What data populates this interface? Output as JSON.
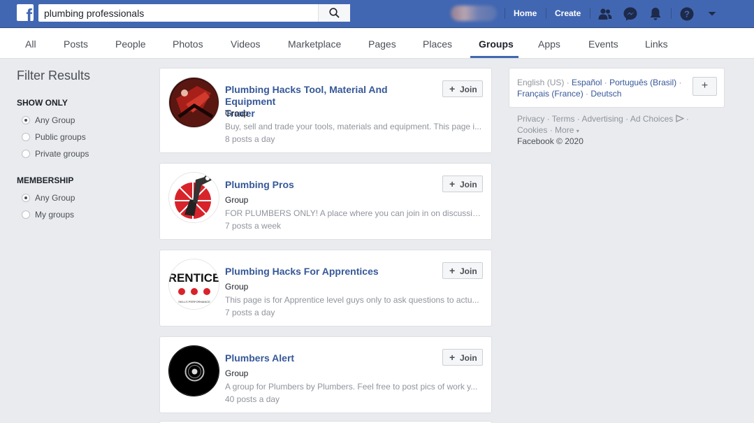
{
  "search": {
    "query": "plumbing professionals"
  },
  "header": {
    "home_label": "Home",
    "create_label": "Create",
    "icons": [
      "friends-icon",
      "messenger-icon",
      "notifications-icon",
      "help-icon",
      "account-menu-icon"
    ],
    "brand_color": "#4267b2"
  },
  "tabs": [
    {
      "label": "All"
    },
    {
      "label": "Posts"
    },
    {
      "label": "People"
    },
    {
      "label": "Photos"
    },
    {
      "label": "Videos"
    },
    {
      "label": "Marketplace"
    },
    {
      "label": "Pages"
    },
    {
      "label": "Places"
    },
    {
      "label": "Groups",
      "active": true
    },
    {
      "label": "Apps"
    },
    {
      "label": "Events"
    },
    {
      "label": "Links"
    }
  ],
  "filters": {
    "title": "Filter Results",
    "show_only": {
      "heading": "SHOW ONLY",
      "options": [
        {
          "label": "Any Group",
          "checked": true
        },
        {
          "label": "Public groups",
          "checked": false
        },
        {
          "label": "Private groups",
          "checked": false
        }
      ]
    },
    "membership": {
      "heading": "MEMBERSHIP",
      "options": [
        {
          "label": "Any Group",
          "checked": true
        },
        {
          "label": "My groups",
          "checked": false
        }
      ]
    }
  },
  "results": [
    {
      "title_line1": "Plumbing Hacks Tool, Material And Equipment",
      "title_line2": "Trader",
      "type": "Group",
      "description": "Buy, sell and trade your tools, materials and equipment. This page i...",
      "activity": "8 posts a day",
      "join_label": "Join"
    },
    {
      "title_line1": "Plumbing Pros",
      "type": "Group",
      "description": "FOR PLUMBERS ONLY! A place where you can join in on discussion...",
      "activity": "7 posts a week",
      "join_label": "Join"
    },
    {
      "title_line1": "Plumbing Hacks For Apprentices",
      "type": "Group",
      "description": "This page is for Apprentice level guys only to ask questions to actu...",
      "activity": "7 posts a day",
      "join_label": "Join",
      "avatar_text": "RENTICE",
      "avatar_subtext": "SKILLS  PERFORMANCE"
    },
    {
      "title_line1": "Plumbers Alert",
      "type": "Group",
      "description": "A group for Plumbers by Plumbers. Feel free to post pics of work y...",
      "activity": "40 posts a day",
      "join_label": "Join"
    }
  ],
  "languages": {
    "current": "English (US)",
    "others": [
      "Español",
      "Português (Brasil)",
      "Français (France)",
      "Deutsch"
    ],
    "add_label": "+"
  },
  "footer": {
    "links_line1": [
      "Privacy",
      "Terms",
      "Advertising",
      "Ad Choices"
    ],
    "links_line2": [
      "Cookies",
      "More"
    ],
    "copyright": "Facebook © 2020"
  }
}
